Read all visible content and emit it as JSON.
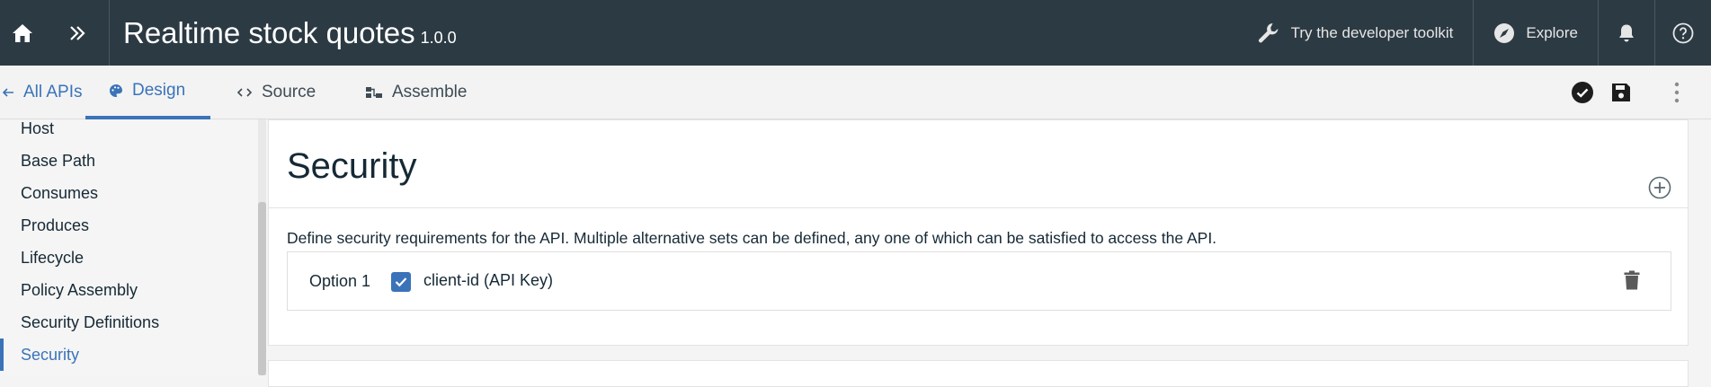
{
  "header": {
    "title": "Realtime stock quotes",
    "version": "1.0.0",
    "home_icon": "home-icon",
    "expand_icon": "double-chevron-right-icon",
    "toolkit_label": "Try the developer toolkit",
    "explore_label": "Explore",
    "notifications_icon": "bell-icon",
    "help_icon": "help-icon"
  },
  "subnav": {
    "back_label": "All APIs",
    "tabs": [
      {
        "label": "Design",
        "icon": "palette-icon",
        "active": true
      },
      {
        "label": "Source",
        "icon": "code-icon",
        "active": false
      },
      {
        "label": "Assemble",
        "icon": "assemble-icon",
        "active": false
      }
    ],
    "validate_icon": "check-circle-icon",
    "save_icon": "save-icon",
    "more_icon": "overflow-menu-icon"
  },
  "sidebar": {
    "items": [
      {
        "label": "Host",
        "active": false
      },
      {
        "label": "Base Path",
        "active": false
      },
      {
        "label": "Consumes",
        "active": false
      },
      {
        "label": "Produces",
        "active": false
      },
      {
        "label": "Lifecycle",
        "active": false
      },
      {
        "label": "Policy Assembly",
        "active": false
      },
      {
        "label": "Security Definitions",
        "active": false
      },
      {
        "label": "Security",
        "active": true
      }
    ]
  },
  "main": {
    "section_title": "Security",
    "add_icon": "add-circle-icon",
    "description": "Define security requirements for the API. Multiple alternative sets can be defined, any one of which can be satisfied to access the API.",
    "options": [
      {
        "label": "Option 1",
        "requirement": "client-id (API Key)",
        "checked": true
      }
    ],
    "delete_icon": "trash-icon"
  },
  "colors": {
    "header_bg": "#2c3a43",
    "accent": "#3b73b9"
  }
}
